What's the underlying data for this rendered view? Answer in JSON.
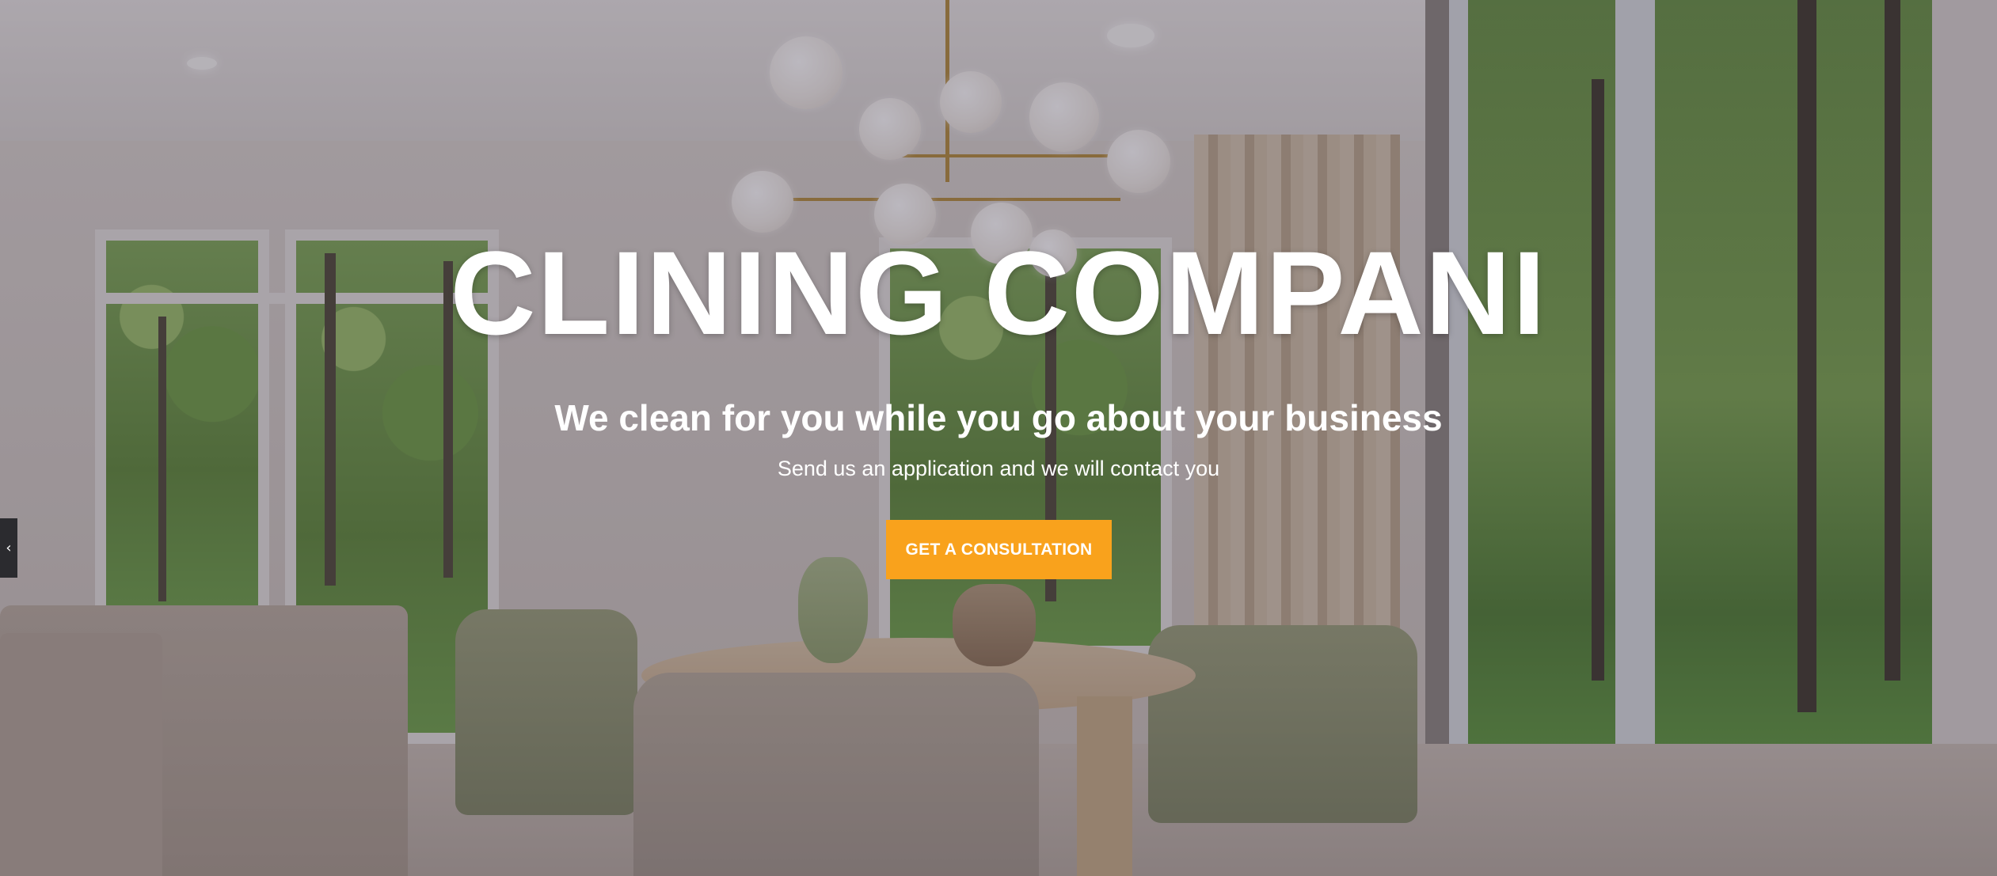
{
  "hero": {
    "title": "CLINING COMPANI",
    "subtitle": "We clean for you while you go about your business",
    "tagline": "Send us an application and we will contact you",
    "cta_label": "GET A CONSULTATION",
    "accent_color": "#f9a21c",
    "slider_prev_icon": "chevron-left-icon",
    "slider_prev_glyph": "‹"
  }
}
